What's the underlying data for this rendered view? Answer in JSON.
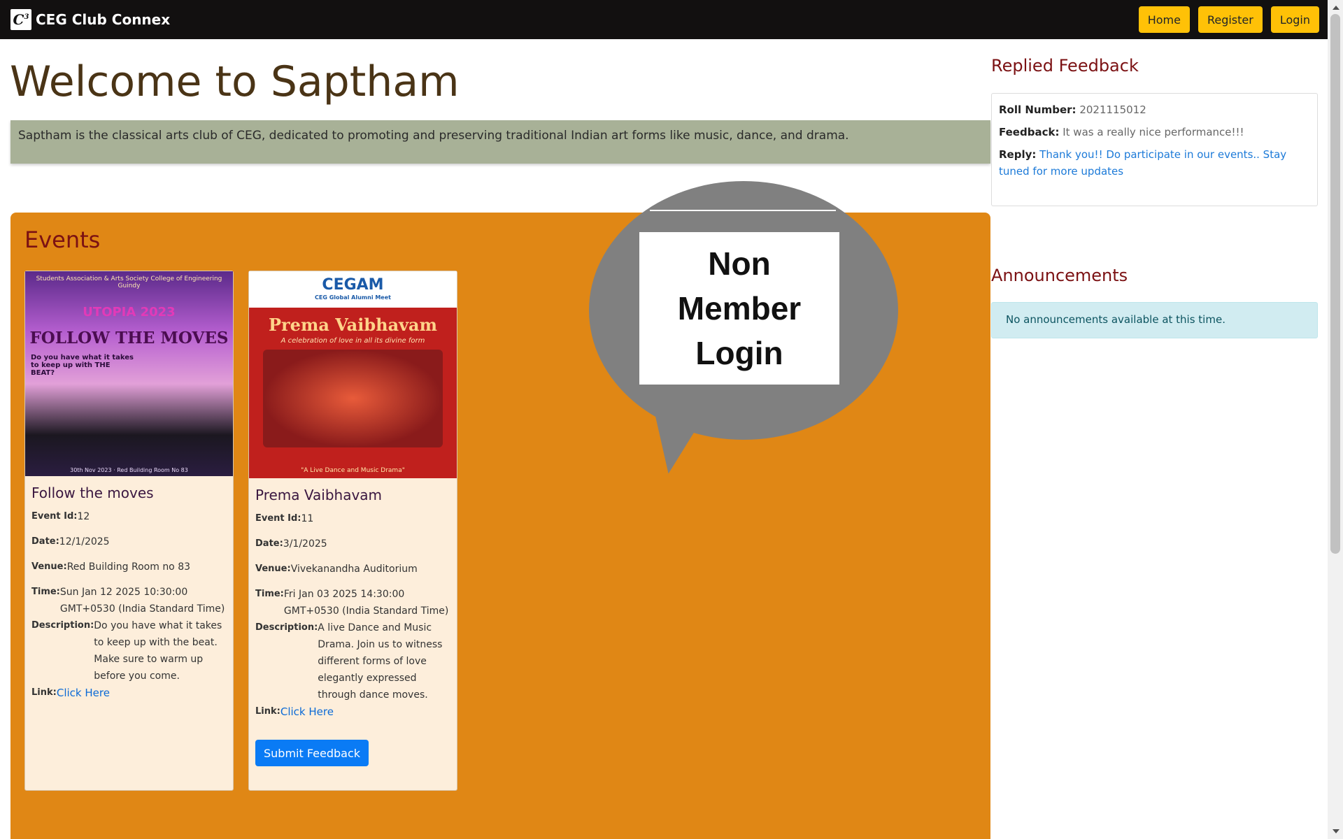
{
  "navbar": {
    "logo_text": "C",
    "logo_sup": "3",
    "brand": "CEG Club Connex",
    "buttons": [
      "Home",
      "Register",
      "Login"
    ]
  },
  "main": {
    "title": "Welcome to Saptham",
    "description": "Saptham is the classical arts club of CEG, dedicated to promoting and preserving traditional Indian art forms like music, dance, and drama."
  },
  "events": {
    "heading": "Events",
    "labels": {
      "event_id": "Event Id:",
      "date": "Date:",
      "venue": "Venue:",
      "time": "Time:",
      "description": "Description:",
      "link": "Link:"
    },
    "items": [
      {
        "title": "Follow the moves",
        "event_id": "12",
        "date": "12/1/2025",
        "venue": "Red Building Room no 83",
        "time": "Sun Jan 12 2025 10:30:00 GMT+0530 (India Standard Time)",
        "description": "Do you have what it takes to keep up with the beat. Make sure to warm up before you come.",
        "link_text": "Click Here",
        "poster": {
          "header": "Students Association & Arts Society College of Engineering Guindy",
          "tag": "UTOPIA 2023",
          "headline": "FOLLOW THE MOVES",
          "question": "Do you have what it takes to keep up with THE BEAT?",
          "footer": "30th Nov 2023 · Red Building Room No 83"
        }
      },
      {
        "title": "Prema Vaibhavam",
        "event_id": "11",
        "date": "3/1/2025",
        "venue": "Vivekanandha Auditorium",
        "time": "Fri Jan 03 2025 14:30:00 GMT+0530 (India Standard Time)",
        "description": "A live Dance and Music Drama. Join us to witness different forms of love elegantly expressed through dance moves.",
        "link_text": "Click Here",
        "button": "Submit Feedback",
        "poster": {
          "header": "CEGAM",
          "header_sub": "CEG Global Alumni Meet",
          "headline": "Prema Vaibhavam",
          "subline": "A celebration of love in all its divine form",
          "footer": "\"A Live Dance and Music Drama\""
        }
      }
    ]
  },
  "overlay": {
    "text": "Non Member Login"
  },
  "sidebar": {
    "feedback_heading": "Replied Feedback",
    "feedback": {
      "roll_label": "Roll Number:",
      "roll_value": "2021115012",
      "feedback_label": "Feedback:",
      "feedback_value": "It was a really nice performance!!!",
      "reply_label": "Reply:",
      "reply_value": "Thank you!! Do participate in our events.. Stay tuned for more updates"
    },
    "announcements_heading": "Announcements",
    "announcements_empty": "No announcements available at this time."
  },
  "colors": {
    "navbar": "#121010",
    "nav_button": "#ffc107",
    "title": "#4a3416",
    "events_panel": "#e08715",
    "heading_red": "#7b1113",
    "card_bg": "#fdeedb",
    "submit_button": "#0a7bf5",
    "announcement_bg": "#d1ecf1"
  }
}
